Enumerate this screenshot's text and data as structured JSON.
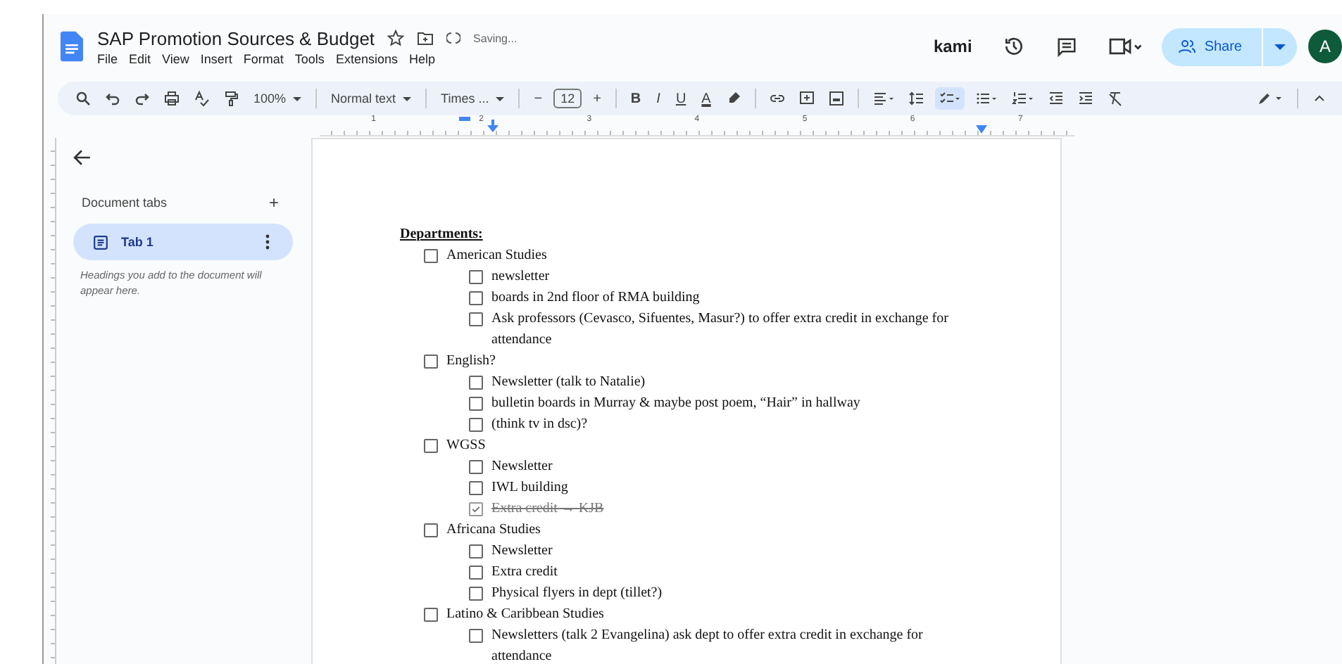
{
  "document": {
    "title": "SAP Promotion Sources & Budget",
    "status": "Saving...",
    "starred": false
  },
  "menu": [
    "File",
    "Edit",
    "View",
    "Insert",
    "Format",
    "Tools",
    "Extensions",
    "Help"
  ],
  "header": {
    "extension": "kami",
    "share": "Share",
    "avatar": "A"
  },
  "toolbar": {
    "zoom": "100%",
    "style": "Normal text",
    "font": "Times ...",
    "minus": "−",
    "size": "12",
    "plus": "+",
    "bold": "B",
    "italic": "I",
    "underline": "U",
    "text_color_letter": "A",
    "checklist_selected": true
  },
  "ruler": [
    "1",
    "2",
    "3",
    "4",
    "5",
    "6",
    "7"
  ],
  "sidebar": {
    "title": "Document tabs",
    "add": "+",
    "tabs": [
      {
        "label": "Tab 1",
        "selected": true
      }
    ],
    "hint": "Headings you add to the document will appear here."
  },
  "doc": {
    "heading": "Departments:",
    "items": [
      {
        "text": "American Studies",
        "checked": false,
        "children": [
          {
            "text": "newsletter",
            "checked": false
          },
          {
            "text": "boards in 2nd floor of RMA building",
            "checked": false
          },
          {
            "text": "Ask professors (Cevasco, Sifuentes, Masur?) to offer extra credit in exchange for attendance",
            "checked": false
          }
        ]
      },
      {
        "text": "English?",
        "checked": false,
        "children": [
          {
            "text": "Newsletter (talk to Natalie)",
            "checked": false
          },
          {
            "text": "bulletin boards in Murray & maybe post poem, “Hair” in hallway",
            "checked": false
          },
          {
            "text": "(think tv in dsc)?",
            "checked": false
          }
        ]
      },
      {
        "text": "WGSS",
        "checked": false,
        "children": [
          {
            "text": "Newsletter",
            "checked": false
          },
          {
            "text": "IWL building",
            "checked": false
          },
          {
            "text": "Extra credit → KJB",
            "checked": true
          }
        ]
      },
      {
        "text": "Africana Studies",
        "checked": false,
        "children": [
          {
            "text": "Newsletter",
            "checked": false
          },
          {
            "text": "Extra credit",
            "checked": false
          },
          {
            "text": "Physical flyers in dept (tillet?)",
            "checked": false
          }
        ]
      },
      {
        "text": "Latino & Caribbean Studies",
        "checked": false,
        "children": [
          {
            "text": "Newsletters (talk 2 Evangelina) ask dept to offer extra credit in exchange for attendance",
            "checked": false
          }
        ]
      }
    ]
  }
}
